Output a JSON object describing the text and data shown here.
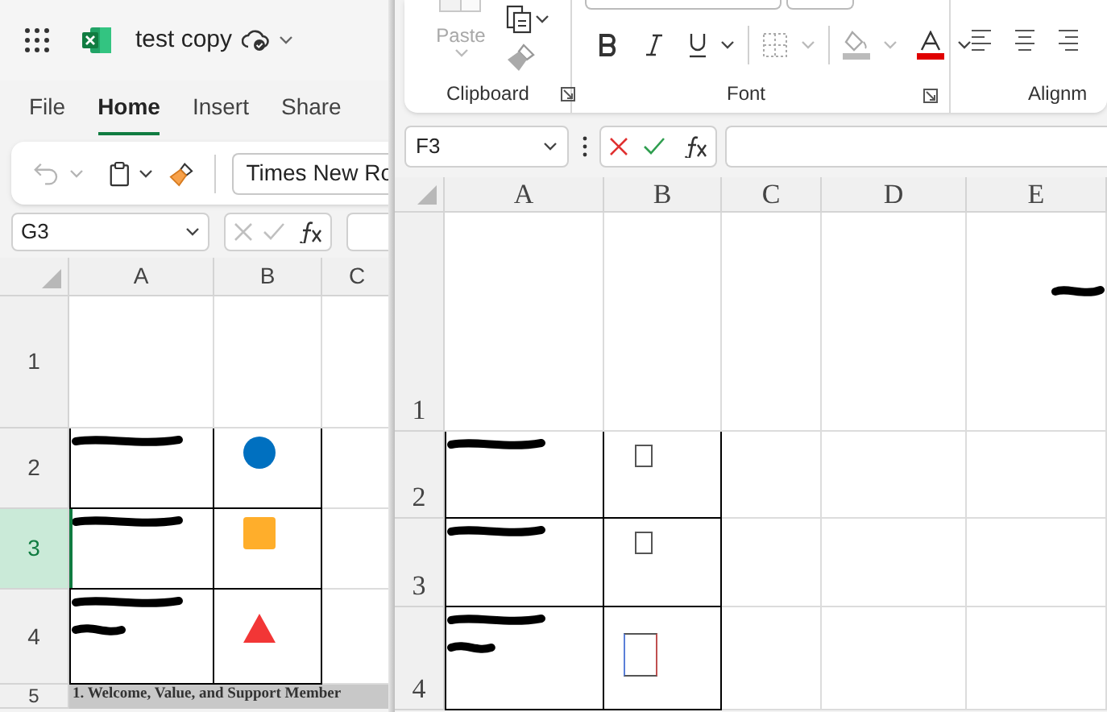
{
  "left_window": {
    "title": "test copy",
    "tabs": [
      {
        "label": "File",
        "selected": false
      },
      {
        "label": "Home",
        "selected": true
      },
      {
        "label": "Insert",
        "selected": false
      },
      {
        "label": "Share",
        "selected": false
      }
    ],
    "font_name": "Times New Ro",
    "name_box": "G3",
    "grid": {
      "columns": [
        "A",
        "B",
        "C"
      ],
      "rows": [
        {
          "header": "1",
          "selected": false,
          "cells": []
        },
        {
          "header": "2",
          "selected": false,
          "cells": [
            {
              "kind": "redacted"
            },
            {
              "kind": "circle",
              "color": "#0070c0"
            }
          ]
        },
        {
          "header": "3",
          "selected": true,
          "cells": [
            {
              "kind": "redacted"
            },
            {
              "kind": "square",
              "color": "#ffae2b"
            }
          ]
        },
        {
          "header": "4",
          "selected": false,
          "cells": [
            {
              "kind": "redacted-two-lines"
            },
            {
              "kind": "triangle",
              "color": "#f23636"
            }
          ]
        },
        {
          "header": "5",
          "selected": false,
          "cells": [
            {
              "kind": "banner",
              "text": "1. Welcome, Value, and Support Member"
            }
          ]
        }
      ]
    }
  },
  "right_window": {
    "paste_label": "Paste",
    "clipboard_label": "Clipboard",
    "font_label": "Font",
    "alignment_label": "Alignm",
    "name_box": "F3",
    "grid": {
      "columns": [
        "A",
        "B",
        "C",
        "D",
        "E"
      ],
      "rows": [
        {
          "header": "1",
          "cells": [
            {
              "kind": "empty"
            },
            {
              "kind": "empty"
            },
            {
              "kind": "empty"
            },
            {
              "kind": "empty"
            },
            {
              "kind": "redacted-short"
            }
          ]
        },
        {
          "header": "2",
          "cells": [
            {
              "kind": "redacted"
            },
            {
              "kind": "glyph-box-small"
            }
          ]
        },
        {
          "header": "3",
          "cells": [
            {
              "kind": "redacted"
            },
            {
              "kind": "glyph-box-small"
            }
          ]
        },
        {
          "header": "4",
          "cells": [
            {
              "kind": "redacted-two-lines"
            },
            {
              "kind": "glyph-box-large"
            }
          ]
        }
      ]
    }
  }
}
